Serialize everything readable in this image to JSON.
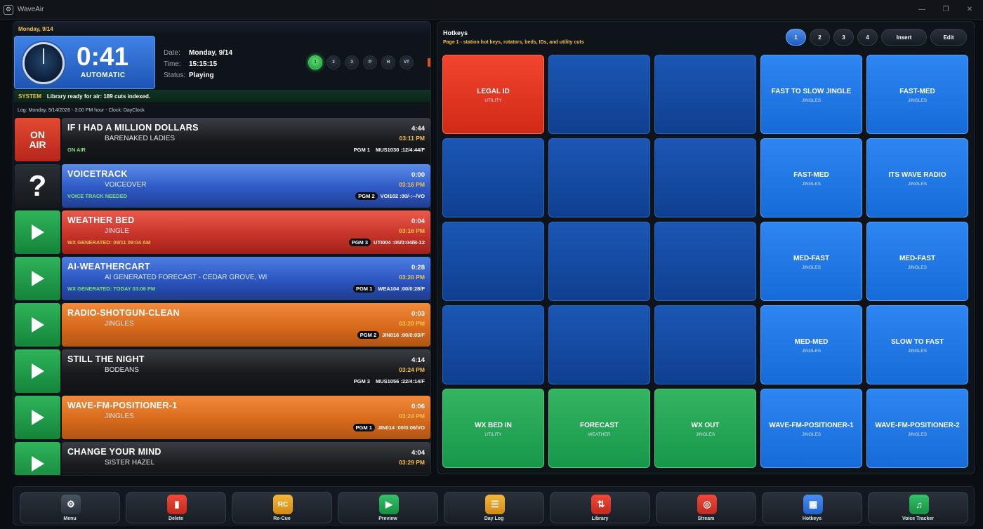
{
  "window": {
    "title": "WaveAir"
  },
  "header": {
    "date_banner": "Monday, 9/14",
    "countdown": "0:41",
    "mode": "AUTOMATIC",
    "date_label": "Date:",
    "date_value": "Monday, 9/14",
    "time_label": "Time:",
    "time_value": "15:15:15",
    "status_label": "Status:",
    "status_value": "Playing",
    "channels": [
      "1",
      "2",
      "3",
      "P",
      "H",
      "VT"
    ],
    "active_channel": "1"
  },
  "system": {
    "tag": "SYSTEM",
    "message": "Library ready for air: 189 cuts indexed."
  },
  "log_line": "Log: Monday, 9/14/2026 - 3:00 PM hour - Clock: DayClock",
  "queue": [
    {
      "icon": "on-air",
      "icon_text": "ON AIR",
      "title": "IF I HAD A MILLION DOLLARS",
      "artist": "BARENAKED LADIES",
      "note": "ON AIR",
      "note_color": "#7be07a",
      "duration": "4:44",
      "start": "03:11 PM",
      "pgm": "PGM 1",
      "pgm_style": "plain",
      "code": "MUS1030 :12/4:44/F",
      "color": "black"
    },
    {
      "icon": "question",
      "icon_text": "?",
      "title": "VOICETRACK",
      "artist": "VOICEOVER",
      "note": "VOICE TRACK NEEDED",
      "note_color": "#7be07a",
      "duration": "0:00",
      "start": "03:16 PM",
      "pgm": "PGM 2",
      "pgm_style": "dark",
      "code": "VOI102 :00/-:--/VO",
      "color": "blue"
    },
    {
      "icon": "play",
      "icon_text": "",
      "title": "WEATHER BED",
      "artist": "JINGLE",
      "note": "WX GENERATED: 09/11 09:04 AM",
      "note_color": "#f2c14e",
      "duration": "0:04",
      "start": "03:16 PM",
      "pgm": "PGM 3",
      "pgm_style": "dark",
      "code": "UTI004 :05/0:04/B-12",
      "color": "red"
    },
    {
      "icon": "play",
      "icon_text": "",
      "title": "AI-WEATHERCART",
      "artist": "AI GENERATED FORECAST - CEDAR GROVE, WI",
      "note": "WX GENERATED: TODAY 03:06 PM",
      "note_color": "#7be07a",
      "duration": "0:28",
      "start": "03:20 PM",
      "pgm": "PGM 1",
      "pgm_style": "dark",
      "code": "WEA104 :00/0:28/F",
      "color": "blue2"
    },
    {
      "icon": "play",
      "icon_text": "",
      "title": "RADIO-SHOTGUN-CLEAN",
      "artist": "JINGLES",
      "note": "",
      "note_color": "#ffffff",
      "duration": "0:03",
      "start": "03:20 PM",
      "pgm": "PGM 2",
      "pgm_style": "dark",
      "code": "JIN016 :00/0:03/F",
      "color": "orange"
    },
    {
      "icon": "play",
      "icon_text": "",
      "title": "STILL THE NIGHT",
      "artist": "BODEANS",
      "note": "",
      "note_color": "#ffffff",
      "duration": "4:14",
      "start": "03:24 PM",
      "pgm": "PGM 3",
      "pgm_style": "plain",
      "code": "MUS1056 :22/4:14/F",
      "color": "black"
    },
    {
      "icon": "play",
      "icon_text": "",
      "title": "WAVE-FM-POSITIONER-1",
      "artist": "JINGLES",
      "note": "",
      "note_color": "#ffffff",
      "duration": "0:06",
      "start": "03:24 PM",
      "pgm": "PGM 1",
      "pgm_style": "dark",
      "code": "JIN014 :00/0:06/VO",
      "color": "orange"
    },
    {
      "icon": "play",
      "icon_text": "",
      "title": "CHANGE YOUR MIND",
      "artist": "SISTER HAZEL",
      "note": "",
      "note_color": "#ffffff",
      "duration": "4:04",
      "start": "03:29 PM",
      "pgm": "",
      "pgm_style": "plain",
      "code": "",
      "color": "black"
    }
  ],
  "hotkeys": {
    "title": "Hotkeys",
    "subtitle": "Page 1 - station hot keys, rotators, beds, IDs, and utility cuts",
    "pages": [
      "1",
      "2",
      "3",
      "4"
    ],
    "active_page": "1",
    "insert_label": "Insert",
    "edit_label": "Edit",
    "cells": [
      {
        "label": "LEGAL ID",
        "sub": "UTILITY",
        "color": "red"
      },
      {
        "label": "",
        "sub": "",
        "color": "dark"
      },
      {
        "label": "",
        "sub": "",
        "color": "dark"
      },
      {
        "label": "FAST TO SLOW JINGLE",
        "sub": "JINGLES",
        "color": "blue"
      },
      {
        "label": "FAST-MED",
        "sub": "JINGLES",
        "color": "blue"
      },
      {
        "label": "",
        "sub": "",
        "color": "dark"
      },
      {
        "label": "",
        "sub": "",
        "color": "dark"
      },
      {
        "label": "",
        "sub": "",
        "color": "dark"
      },
      {
        "label": "FAST-MED",
        "sub": "JINGLES",
        "color": "blue"
      },
      {
        "label": "ITS WAVE RADIO",
        "sub": "JINGLES",
        "color": "blue"
      },
      {
        "label": "",
        "sub": "",
        "color": "dark"
      },
      {
        "label": "",
        "sub": "",
        "color": "dark"
      },
      {
        "label": "",
        "sub": "",
        "color": "dark"
      },
      {
        "label": "MED-FAST",
        "sub": "JINGLES",
        "color": "blue"
      },
      {
        "label": "MED-FAST",
        "sub": "JINGLES",
        "color": "blue"
      },
      {
        "label": "",
        "sub": "",
        "color": "dark"
      },
      {
        "label": "",
        "sub": "",
        "color": "dark"
      },
      {
        "label": "",
        "sub": "",
        "color": "dark"
      },
      {
        "label": "MED-MED",
        "sub": "JINGLES",
        "color": "blue"
      },
      {
        "label": "SLOW TO FAST",
        "sub": "JINGLES",
        "color": "blue"
      },
      {
        "label": "WX BED IN",
        "sub": "UTILITY",
        "color": "green"
      },
      {
        "label": "FORECAST",
        "sub": "WEATHER",
        "color": "green"
      },
      {
        "label": "WX OUT",
        "sub": "JINGLES",
        "color": "green"
      },
      {
        "label": "WAVE-FM-POSITIONER-1",
        "sub": "JINGLES",
        "color": "blue"
      },
      {
        "label": "WAVE-FM-POSITIONER-2",
        "sub": "JINGLES",
        "color": "blue"
      }
    ]
  },
  "toolbar": [
    {
      "id": "menu",
      "label": "Menu",
      "icon": "gear-icon",
      "glyph": "⚙"
    },
    {
      "id": "delete",
      "label": "Delete",
      "icon": "trash-icon",
      "glyph": "▮"
    },
    {
      "id": "recue",
      "label": "Re-Cue",
      "icon": "rc-icon",
      "glyph": "RC"
    },
    {
      "id": "preview",
      "label": "Preview",
      "icon": "play-icon",
      "glyph": "▶"
    },
    {
      "id": "daylog",
      "label": "Day Log",
      "icon": "document-icon",
      "glyph": "☰"
    },
    {
      "id": "library",
      "label": "Library",
      "icon": "sort-arrows-icon",
      "glyph": "⇅"
    },
    {
      "id": "stream",
      "label": "Stream",
      "icon": "stream-icon",
      "glyph": "◎"
    },
    {
      "id": "hotkeys",
      "label": "Hotkeys",
      "icon": "grid-icon",
      "glyph": "▦"
    },
    {
      "id": "voicetracker",
      "label": "Voice Tracker",
      "icon": "music-note-icon",
      "glyph": "♫"
    }
  ]
}
